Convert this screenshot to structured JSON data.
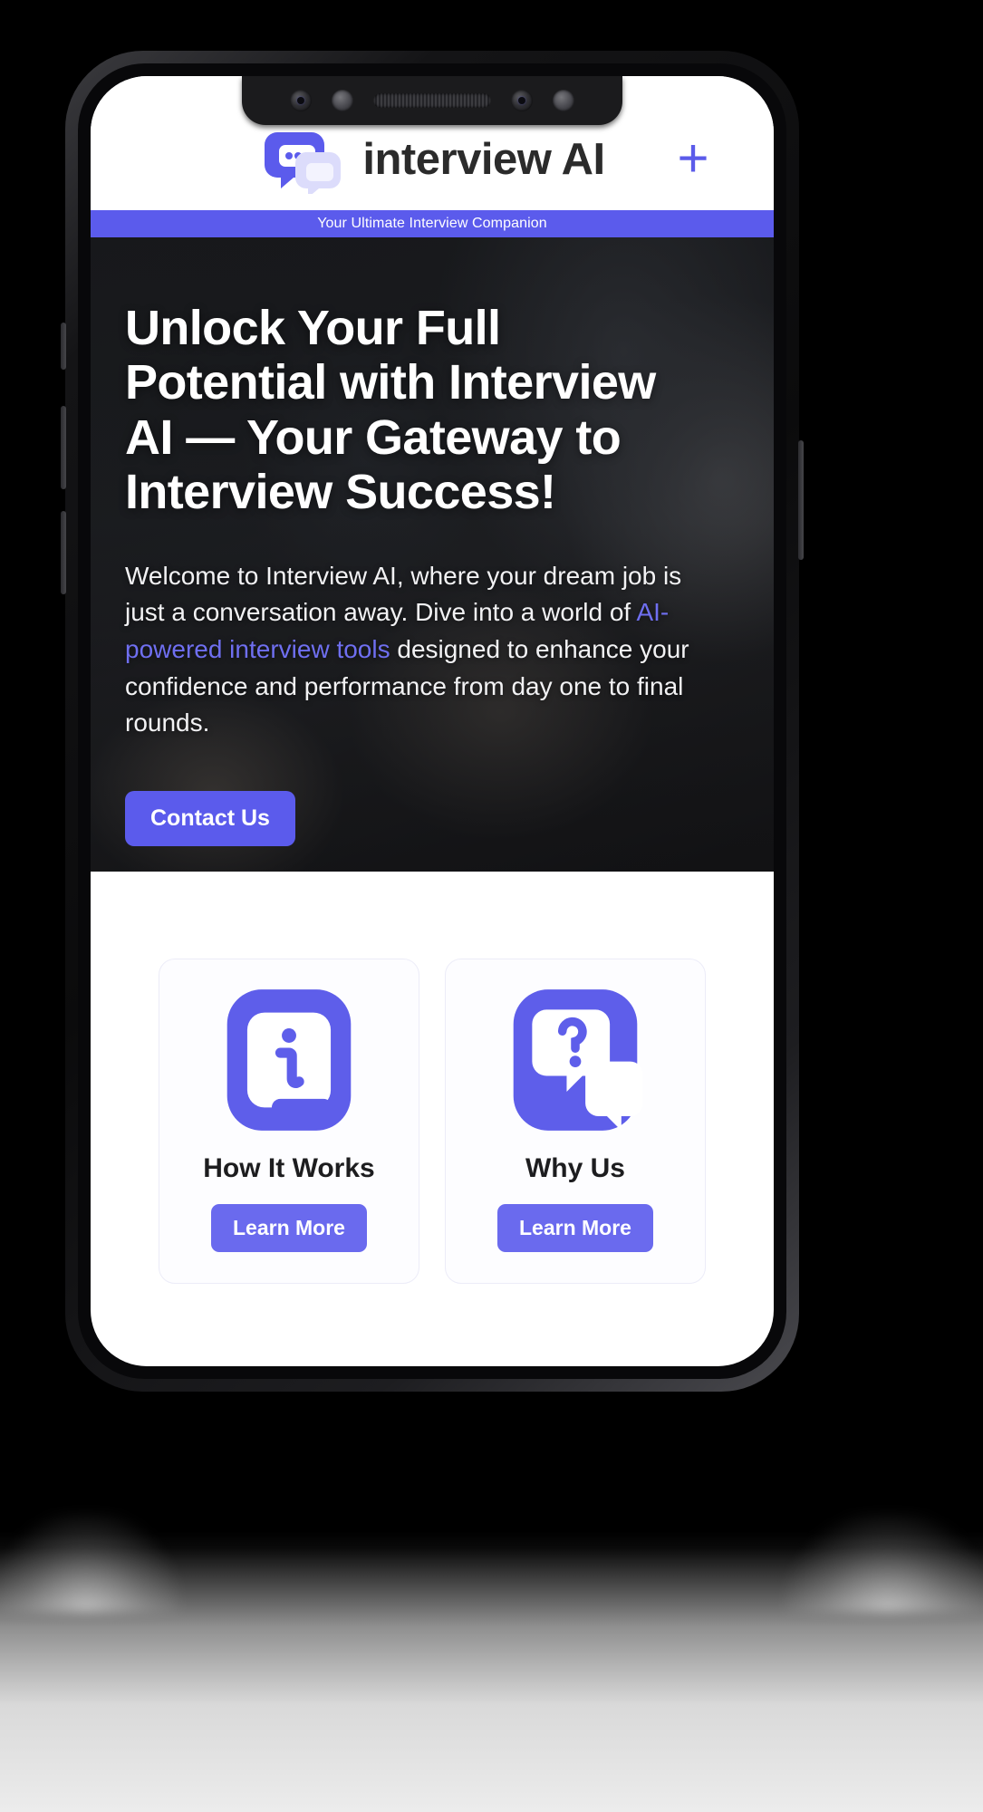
{
  "header": {
    "brand_name": "interview AI",
    "logo_icon": "chat-bubbles-logo-icon",
    "plus_icon": "plus-icon",
    "plus_label": "+"
  },
  "tagline": {
    "text": "Your Ultimate Interview Companion"
  },
  "hero": {
    "title": "Unlock Your Full Potential with Interview AI — Your Gateway to Interview Success!",
    "paragraph_before_link": "Welcome to Interview AI, where your dream job is just a conversation away. Dive into a world of ",
    "link_text": "AI-powered interview tools",
    "paragraph_after_link": " designed to enhance your confidence and performance from day one to final rounds.",
    "cta_label": "Contact Us"
  },
  "cards": [
    {
      "title": "How It Works",
      "button_label": "Learn More",
      "icon": "info-document-icon"
    },
    {
      "title": "Why Us",
      "button_label": "Learn More",
      "icon": "question-chat-icon"
    }
  ],
  "colors": {
    "accent": "#5b5bec",
    "accent_light": "#6a6aee",
    "link": "#6f6ff0",
    "text_dark": "#1d1d1f",
    "card_bg": "#fdfdff",
    "card_border": "#ececf8"
  },
  "device": {
    "notch_sensors": [
      "front-camera-icon",
      "proximity-sensor-icon",
      "earpiece-speaker-icon",
      "ir-sensor-icon",
      "ambient-sensor-icon"
    ]
  }
}
